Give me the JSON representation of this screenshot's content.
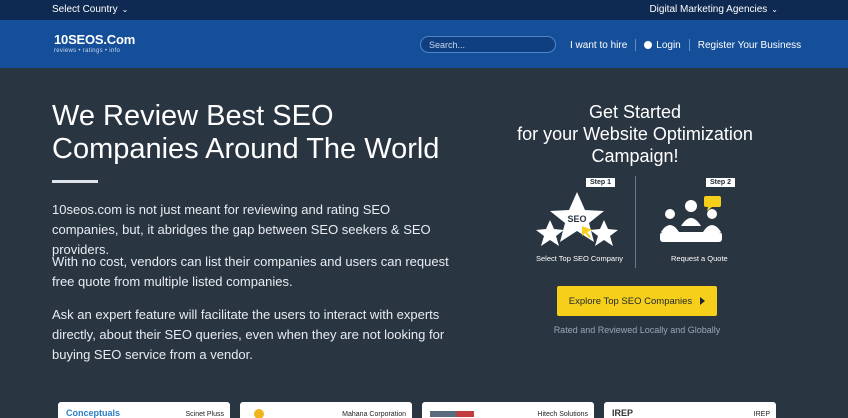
{
  "topbar": {
    "country_label": "Select Country",
    "agencies_label": "Digital Marketing Agencies"
  },
  "nav": {
    "logo_prefix": "10",
    "logo_name": "SEOS.Com",
    "logo_tagline": "reviews • ratings • info",
    "search_placeholder": "Search...",
    "hire_label": "I want to hire",
    "login_label": "Login",
    "register_label": "Register Your Business"
  },
  "hero": {
    "title_line1": "We Review Best SEO",
    "title_line2": "Companies Around The World",
    "paragraph1": "10seos.com is not just meant for reviewing and rating SEO companies, but, it abridges the gap between SEO seekers & SEO providers.",
    "paragraph2": "With no cost, vendors can list their companies and users can request free quote from multiple listed companies.",
    "paragraph3": "Ask an expert feature will facilitate the users to interact with experts directly, about their SEO queries, even when they are not looking for buying SEO service from a vendor."
  },
  "get_started": {
    "line1": "Get Started",
    "line2": "for your Website Optimization",
    "line3": "Campaign!",
    "step1_badge": "Step 1",
    "step1_label": "Select Top SEO Company",
    "step1_icon_text": "SEO",
    "step2_badge": "Step 2",
    "step2_label": "Request a Quote",
    "cta_label": "Explore Top SEO Companies",
    "rated_text": "Rated and Reviewed Locally and Globally"
  },
  "cards": [
    {
      "logo_text": "Conceptuals",
      "name": "Scinet Pluss"
    },
    {
      "logo_text": "",
      "name": "Mahana Corporation"
    },
    {
      "logo_text": "",
      "name": "Hitech Solutions"
    },
    {
      "logo_text": "IREP",
      "name": "IREP"
    }
  ],
  "colors": {
    "topbar": "#0f2a52",
    "nav": "#154f9a",
    "hero_bg": "#2a3542",
    "cta": "#f6cf1a"
  }
}
